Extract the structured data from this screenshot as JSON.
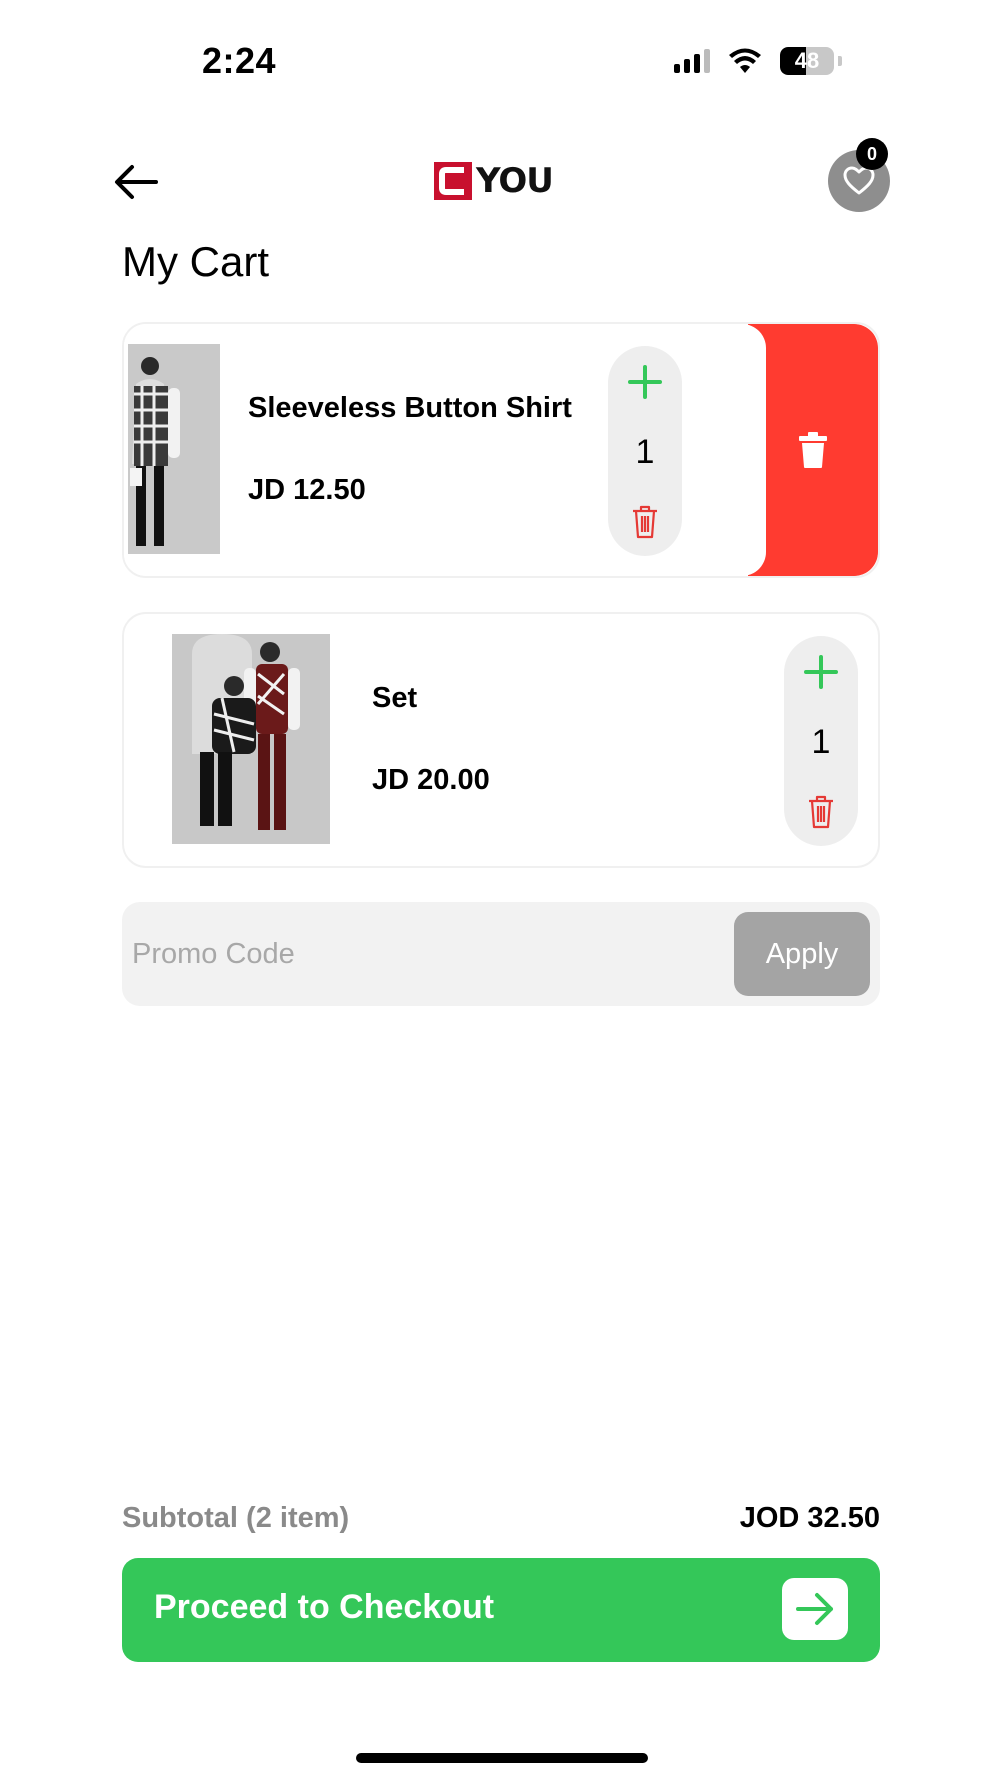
{
  "status_bar": {
    "time": "2:24",
    "battery": "48",
    "battery_level": 0.48
  },
  "header": {
    "logo_text": "YOU",
    "wishlist_count": "0"
  },
  "page_title": "My Cart",
  "cart_items": [
    {
      "name": "Sleeveless Button Shirt",
      "price": "JD 12.50",
      "quantity": "1"
    },
    {
      "name": "Set",
      "price": "JD 20.00",
      "quantity": "1"
    }
  ],
  "promo": {
    "placeholder": "Promo Code",
    "apply_label": "Apply"
  },
  "summary": {
    "subtotal_label": "Subtotal (2 item)",
    "subtotal_value": "JOD 32.50"
  },
  "checkout": {
    "label": "Proceed to Checkout"
  },
  "colors": {
    "accent_green": "#34c759",
    "delete_red": "#ff3b30",
    "brand_red": "#c8102e",
    "stepper_bg": "#eeeeee",
    "apply_gray": "#a4a4a4"
  },
  "icons": [
    "back-arrow-icon",
    "heart-icon",
    "plus-icon",
    "trash-icon",
    "arrow-right-icon",
    "signal-icon",
    "wifi-icon",
    "battery-icon"
  ]
}
